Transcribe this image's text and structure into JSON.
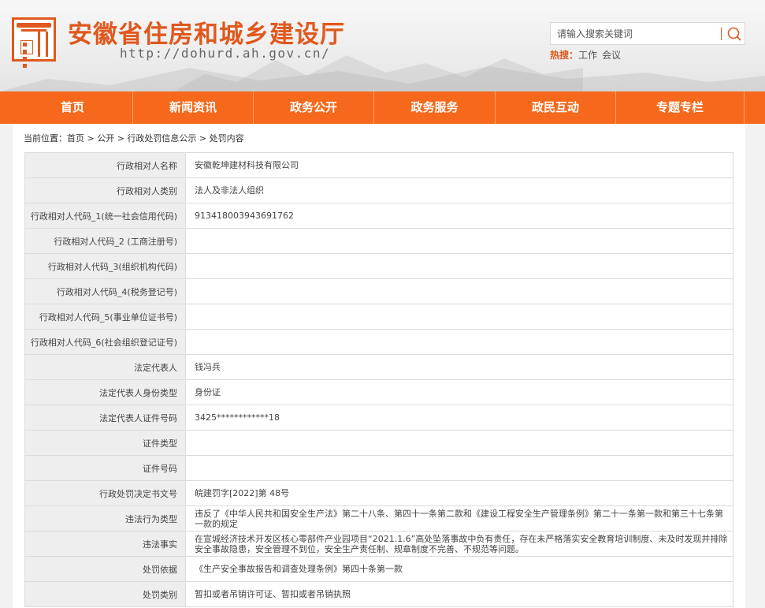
{
  "header": {
    "title": "安徽省住房和城乡建设厅",
    "url": "http://dohurd.ah.gov.cn/",
    "search_placeholder": "请输入搜索关键词",
    "hot_label": "热搜：",
    "hot_keywords": [
      "工作",
      "会议"
    ]
  },
  "nav": {
    "items": [
      "首页",
      "新闻资讯",
      "政务公开",
      "政务服务",
      "政民互动",
      "专题专栏"
    ]
  },
  "breadcrumb": {
    "prefix": "当前位置：",
    "items": [
      "首页",
      "公开",
      "行政处罚信息公示",
      "处罚内容"
    ],
    "sep": " > "
  },
  "table": {
    "rows": [
      {
        "key": "行政相对人名称",
        "value": "安徽乾坤建材科技有限公司"
      },
      {
        "key": "行政相对人类别",
        "value": "法人及非法人组织"
      },
      {
        "key": "行政相对人代码_1(统一社会信用代码)",
        "value": "913418003943691762"
      },
      {
        "key": "行政相对人代码_2 (工商注册号)",
        "value": ""
      },
      {
        "key": "行政相对人代码_3(组织机构代码)",
        "value": ""
      },
      {
        "key": "行政相对人代码_4(税务登记号)",
        "value": ""
      },
      {
        "key": "行政相对人代码_5(事业单位证书号)",
        "value": ""
      },
      {
        "key": "行政相对人代码_6(社会组织登记证号)",
        "value": ""
      },
      {
        "key": "法定代表人",
        "value": "钱冯兵"
      },
      {
        "key": "法定代表人身份类型",
        "value": "身份证"
      },
      {
        "key": "法定代表人证件号码",
        "value": "3425************18"
      },
      {
        "key": "证件类型",
        "value": ""
      },
      {
        "key": "证件号码",
        "value": ""
      },
      {
        "key": "行政处罚决定书文号",
        "value": "皖建罚字[2022]第 48号"
      },
      {
        "key": "违法行为类型",
        "value": "违反了《中华人民共和国安全生产法》第二十八条、第四十一条第二款和《建设工程安全生产管理条例》第二十一条第一款和第三十七条第一款的规定"
      },
      {
        "key": "违法事实",
        "value": "在宣城经济技术开发区核心零部件产业园项目“2021.1.6”高处坠落事故中负有责任，存在未严格落实安全教育培训制度、未及时发现并排除安全事故隐患，安全管理不到位，安全生产责任制、规章制度不完善、不规范等问题。"
      },
      {
        "key": "处罚依据",
        "value": "《生产安全事故报告和调查处理条例》第四十条第一款"
      },
      {
        "key": "处罚类别",
        "value": "暂扣或者吊销许可证、暂扣或者吊销执照"
      }
    ]
  },
  "colors": {
    "brand": "#e0581d",
    "nav_bg": "#f6681b",
    "label_bg": "#eeeeee"
  }
}
